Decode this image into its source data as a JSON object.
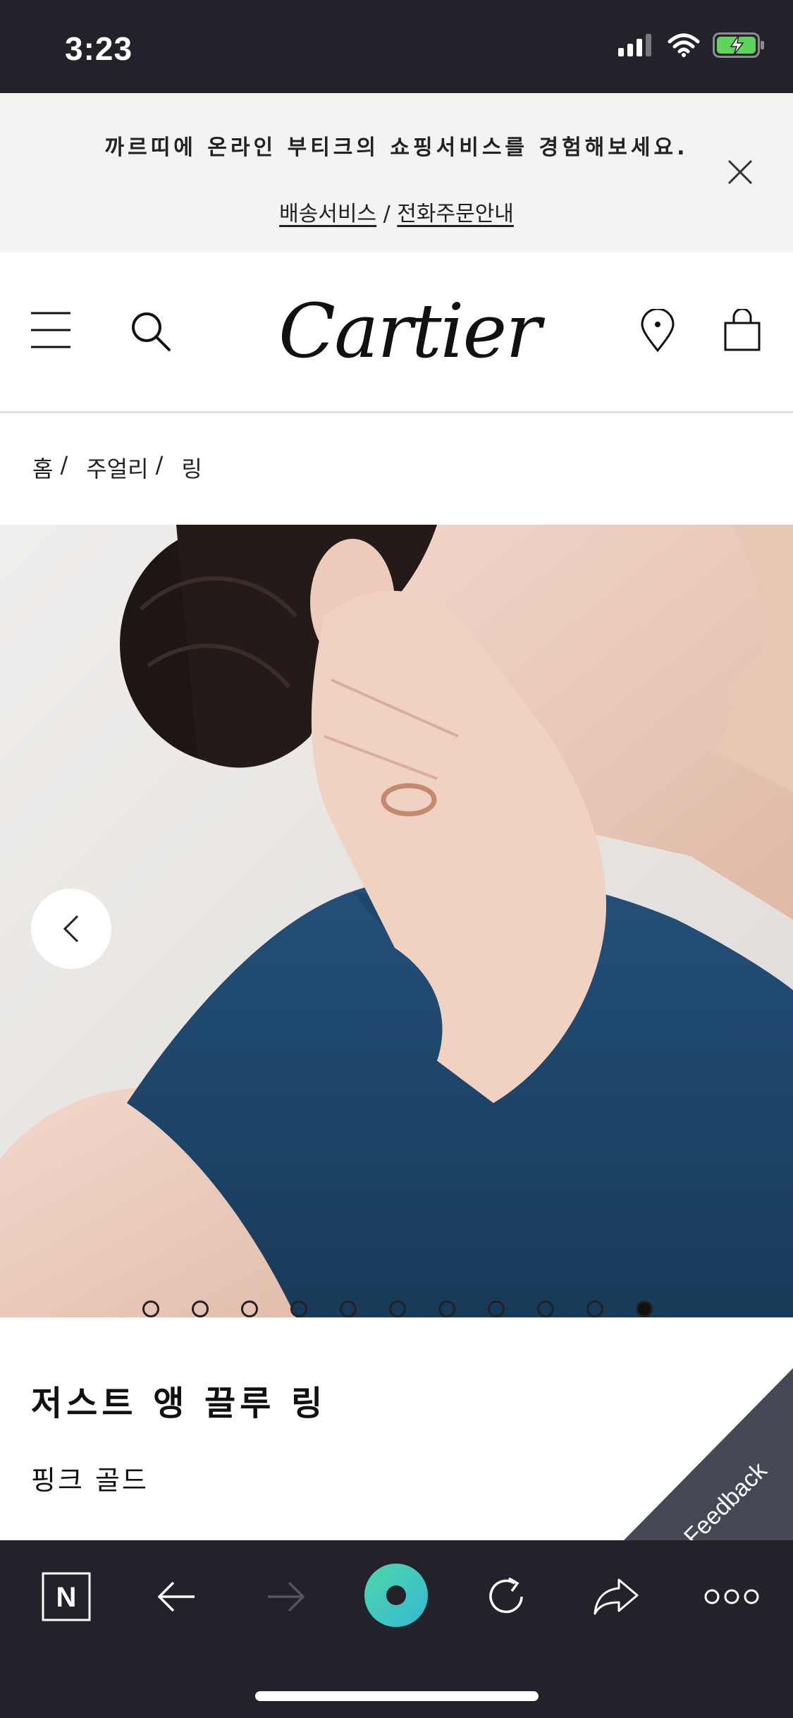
{
  "status_bar": {
    "time": "3:23",
    "icons": [
      "signal-icon",
      "wifi-icon",
      "battery-charging-icon"
    ],
    "battery_color": "#5fd35b"
  },
  "promo": {
    "text": "까르띠에 온라인 부티크의 쇼핑서비스를 경험해보세요.",
    "link_delivery": "배송서비스",
    "separator": "/",
    "link_phone_order": "전화주문안내",
    "close_icon": "close-icon"
  },
  "header": {
    "logo": "Cartier",
    "icons": [
      "menu-icon",
      "search-icon",
      "location-pin-icon",
      "shopping-bag-icon"
    ]
  },
  "breadcrumb": {
    "items": [
      "홈",
      "주얼리",
      "링"
    ],
    "separator": "/"
  },
  "carousel": {
    "slide_count": 11,
    "active_index": 10,
    "prev_icon": "chevron-left-icon"
  },
  "product": {
    "name": "저스트 앵 끌루 링",
    "material": "핑크 골드"
  },
  "feedback": {
    "label": "Feedback",
    "color": "#474856"
  },
  "toolbar": {
    "icons": [
      "naver-n-icon",
      "back-arrow-icon",
      "forward-arrow-icon",
      "home-circle-icon",
      "reload-icon",
      "share-icon",
      "more-dots-icon"
    ],
    "accent_gradient": [
      "#4fd7a8",
      "#35b8d6"
    ],
    "n_label": "N"
  },
  "colors": {
    "dark_bar": "#23222a",
    "banner_bg": "#f3f3f3",
    "dress": "#1f4566"
  }
}
